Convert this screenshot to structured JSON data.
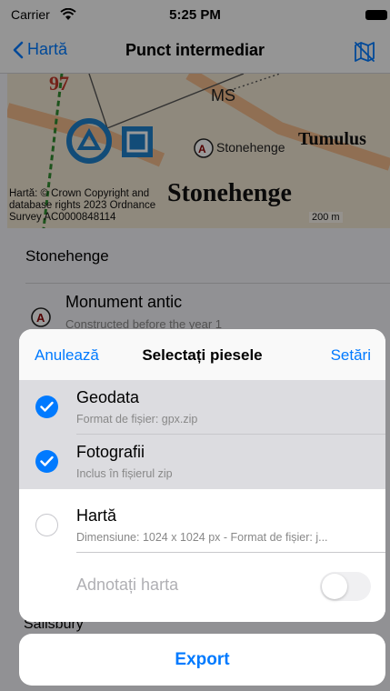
{
  "status_bar": {
    "carrier": "Carrier",
    "time": "5:25 PM"
  },
  "nav": {
    "back_label": "Hartă",
    "title": "Punct intermediar"
  },
  "map": {
    "attribution": "Hartă: © Crown Copyright and database rights 2023 Ordnance Survey AC0000848114",
    "scale_label": "200 m",
    "labels": {
      "ms": "MS",
      "stonehenge_small": "Stonehenge",
      "tumulus": "Tumulus",
      "stonehenge_big": "Stonehenge",
      "ninety_seven": "97"
    }
  },
  "detail": {
    "place_name": "Stonehenge",
    "category_title": "Monument antic",
    "category_subtitle": "Constructed before the year 1",
    "bottom_place": "Salisbury"
  },
  "sheet": {
    "cancel_label": "Anulează",
    "title": "Selectați piesele",
    "settings_label": "Setări",
    "options": [
      {
        "title": "Geodata",
        "subtitle": "Format de fișier: gpx.zip",
        "checked": true
      },
      {
        "title": "Fotografii",
        "subtitle": "Inclus în fișierul zip",
        "checked": true
      },
      {
        "title": "Hartă",
        "subtitle": "Dimensiune: 1024 x 1024 px - Format de fișier: j...",
        "checked": false
      }
    ],
    "annotate_label": "Adnotați harta",
    "annotate_enabled": false
  },
  "export_label": "Export",
  "colors": {
    "accent": "#007aff",
    "selected_row": "#dcdce0",
    "dim": "rgba(0,0,0,0.40)"
  }
}
